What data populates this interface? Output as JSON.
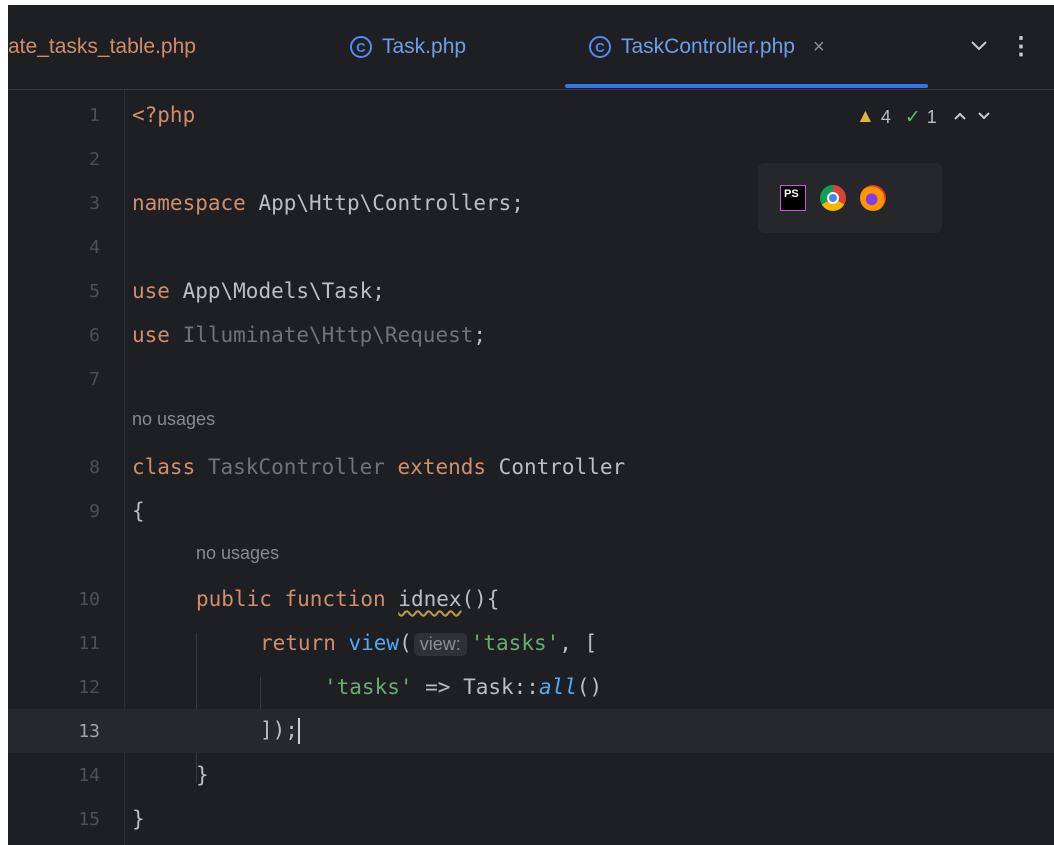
{
  "tabs": [
    {
      "label": "ate_tasks_table.php",
      "active": false
    },
    {
      "label": "Task.php",
      "active": false
    },
    {
      "label": "TaskController.php",
      "active": true
    }
  ],
  "tab_controls": {
    "close": "×",
    "chevron": "⌄",
    "more": "⋮"
  },
  "inspections": {
    "warnings": "4",
    "typos": "1"
  },
  "browser_icons": [
    "phpstorm-icon",
    "chrome-icon",
    "firefox-icon"
  ],
  "hints": {
    "no_usages": "no usages",
    "param_view": "view:"
  },
  "code": {
    "l1": "<?php",
    "l3_kw": "namespace",
    "l3_rest": " App\\Http\\Controllers;",
    "l5_kw": "use",
    "l5_rest": " App\\Models\\Task;",
    "l6_kw": "use",
    "l6_rest": " Illuminate\\Http\\Request",
    "l6_end": ";",
    "l8_kw": "class",
    "l8_name": " TaskController ",
    "l8_ext": "extends",
    "l8_parent": " Controller",
    "l9": "{",
    "l10_public": "public",
    "l10_function": " function ",
    "l10_name": "idnex",
    "l10_end": "(){",
    "l11_return": "return",
    "l11_view": " view",
    "l11_paren": "(",
    "l11_str": "'tasks'",
    "l11_end": ", [",
    "l12_str": "'tasks'",
    "l12_arrow": " => Task::",
    "l12_all": "all",
    "l12_end": "()",
    "l13": "]);",
    "l14": "}",
    "l15": "}"
  },
  "line_numbers": [
    "1",
    "2",
    "3",
    "4",
    "5",
    "6",
    "7",
    "8",
    "9",
    "10",
    "11",
    "12",
    "13",
    "14",
    "15"
  ],
  "colors": {
    "background": "#1e1f22",
    "keyword": "#cf8e6d",
    "string": "#6aab73",
    "function": "#56a8f5",
    "tab_accent": "#3574f0"
  }
}
